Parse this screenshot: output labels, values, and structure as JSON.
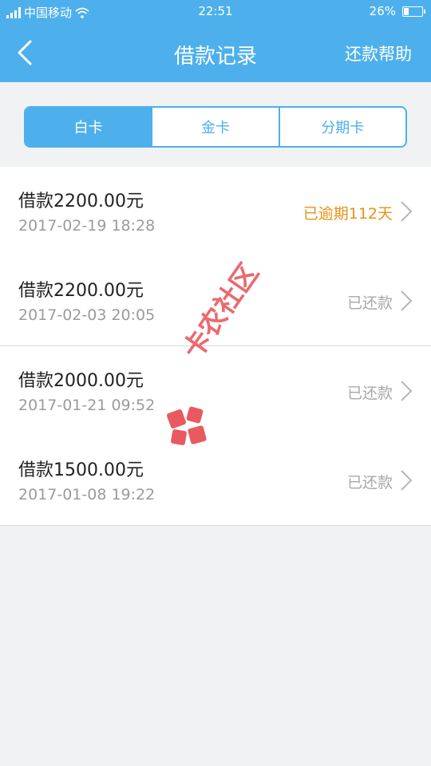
{
  "status_bar": {
    "carrier": "中国移动",
    "time": "22:51",
    "battery": "26%",
    "battery_level": 0.26
  },
  "nav": {
    "title": "借款记录",
    "right_action": "还款帮助",
    "back_icon": "chevron-left-icon"
  },
  "tabs": [
    {
      "label": "白卡",
      "active": true
    },
    {
      "label": "金卡",
      "active": false
    },
    {
      "label": "分期卡",
      "active": false
    }
  ],
  "loans": [
    {
      "title": "借款2200.00元",
      "date": "2017-02-19 18:28",
      "status": "已逾期112天",
      "status_type": "overdue"
    },
    {
      "title": "借款2200.00元",
      "date": "2017-02-03 20:05",
      "status": "已还款",
      "status_type": "repaid"
    },
    {
      "title": "借款2000.00元",
      "date": "2017-01-21 09:52",
      "status": "已还款",
      "status_type": "repaid"
    },
    {
      "title": "借款1500.00元",
      "date": "2017-01-08 19:22",
      "status": "已还款",
      "status_type": "repaid"
    }
  ],
  "watermark": {
    "text": "卡农社区"
  },
  "colors": {
    "primary": "#4db0ec",
    "overdue": "#e99315",
    "muted": "#a8a8a8",
    "watermark": "#e85a5f"
  }
}
